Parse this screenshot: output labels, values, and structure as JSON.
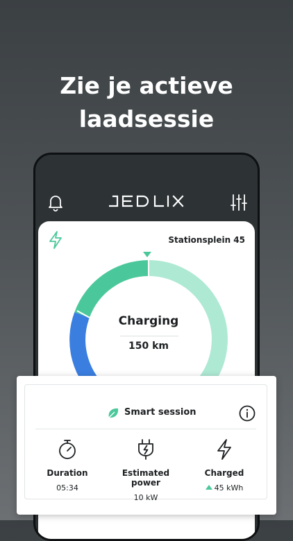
{
  "headline": {
    "line1": "Zie je actieve",
    "line2": "laadsessie"
  },
  "header": {
    "bell_icon": "bell-icon",
    "logo_text": "JEDLIX",
    "filter_icon": "filter-sliders-icon"
  },
  "charging_card": {
    "station_name": "Stationsplein 45",
    "status": "Charging",
    "range": "150 km",
    "bolt_icon": "bolt-icon",
    "charge_level": 0.22,
    "colors": {
      "accent": "#4bc89b",
      "light_accent": "#aee9d4",
      "blue": "#3a7ee0"
    }
  },
  "smart_session": {
    "title": "Smart session",
    "leaf_icon": "leaf-icon",
    "info_icon": "info-icon",
    "stats": [
      {
        "label": "Duration",
        "value": "05:34",
        "icon": "stopwatch-icon"
      },
      {
        "label": "Estimated power",
        "value": "10 kW",
        "icon": "plug-icon"
      },
      {
        "label": "Charged",
        "value": "45 kWh",
        "icon": "bolt-icon"
      }
    ]
  }
}
